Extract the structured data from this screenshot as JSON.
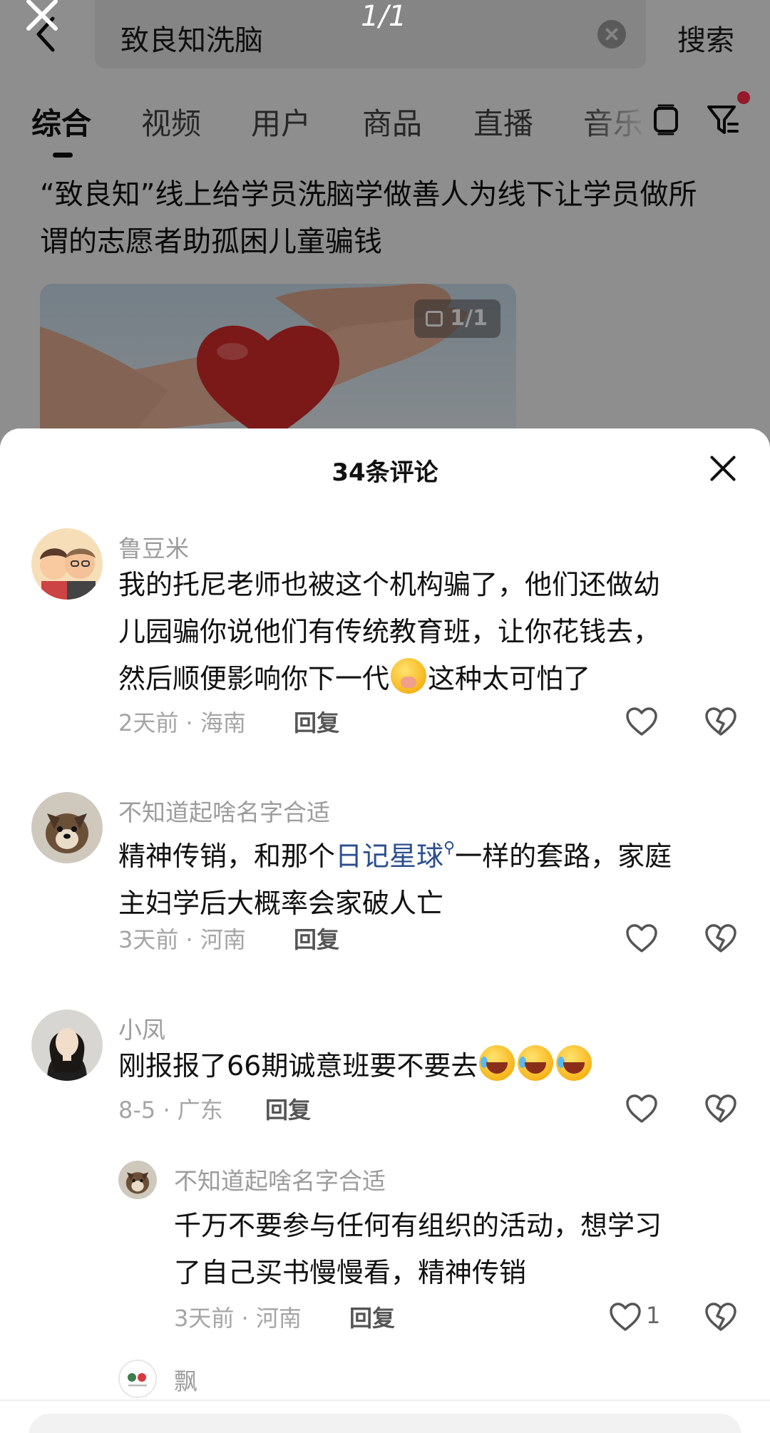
{
  "topbar": {
    "search_query": "致良知洗脑",
    "page_counter": "1/1",
    "search_label": "搜索"
  },
  "tabs": [
    {
      "label": "综合",
      "active": true
    },
    {
      "label": "视频"
    },
    {
      "label": "用户"
    },
    {
      "label": "商品"
    },
    {
      "label": "直播"
    },
    {
      "label": "音乐"
    }
  ],
  "article": {
    "title": "“致良知”线上给学员洗脑学做善人为线下让学员做所谓的志愿者助孤困儿童骗钱",
    "image_counter": "1/1"
  },
  "comments_sheet": {
    "title": "34条评论",
    "comments": [
      {
        "username": "鲁豆米",
        "text_lines": [
          "我的托尼老师也被这个机构骗了，他们还做幼",
          "儿园骗你说他们有传统教育班，让你花钱去，",
          "然后顺便影响你下一代"
        ],
        "text_tail": "这种太可怕了",
        "meta": "2天前 · 海南",
        "reply": "回复"
      },
      {
        "username": "不知道起啥名字合适",
        "text_part1": "精神传销，和那个",
        "link": "日记星球",
        "text_part2": "一样的套路，家庭",
        "text_line2": "主妇学后大概率会家破人亡",
        "meta": "3天前 · 河南",
        "reply": "回复"
      },
      {
        "username": "小凤",
        "text": "刚报报了66期诚意班要不要去",
        "meta": "8-5 · 广东",
        "reply": "回复"
      },
      {
        "username": "不知道起啥名字合适",
        "text_lines": [
          "千万不要参与任何有组织的活动，想学习",
          "了自己买书慢慢看，精神传销"
        ],
        "meta": "3天前 · 河南",
        "reply": "回复",
        "likes": "1"
      },
      {
        "username": "飘"
      }
    ]
  },
  "colors": {
    "link": "#2b4f8f",
    "badge_red": "#ff2e4d",
    "meta_gray": "#a5a5a5"
  }
}
